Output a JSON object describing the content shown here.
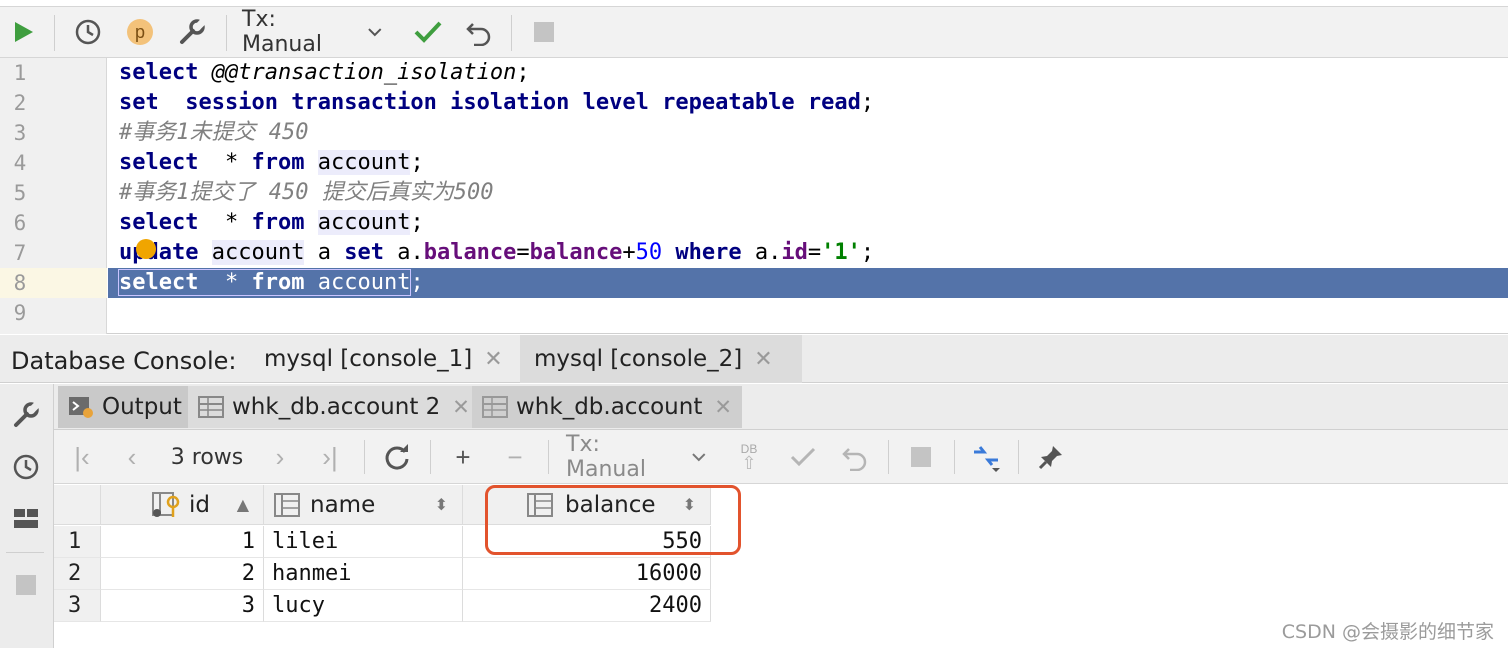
{
  "toolbar": {
    "run_icon": "play-icon",
    "history_icon": "clock-icon",
    "profile_badge": "p",
    "settings_icon": "wrench-icon",
    "tx_mode": "Tx: Manual",
    "commit_icon": "check-icon",
    "rollback_icon": "undo-icon",
    "stop_icon": "stop-icon"
  },
  "editor": {
    "line_numbers": [
      "1",
      "2",
      "3",
      "4",
      "5",
      "6",
      "7",
      "8",
      "9"
    ],
    "lines": {
      "l1_kw": "select",
      "l1_rest": "@@transaction_isolation",
      "l1_end": ";",
      "l2_kw1": "set",
      "l2_kw2": "session",
      "l2_kw3": "transaction",
      "l2_kw4": "isolation",
      "l2_kw5": "level",
      "l2_kw6": "repeatable",
      "l2_kw7": "read",
      "l2_end": ";",
      "l3_comment": "#事务1未提交 450",
      "l4_kw": "select",
      "l4_star": "*",
      "l4_from": "from",
      "l4_table": "account",
      "l4_end": ";",
      "l5_comment": "#事务1提交了 450 提交后真实为500",
      "l6_kw": "select",
      "l6_star": "*",
      "l6_from": "from",
      "l6_table": "account",
      "l6_end": ";",
      "l7_kw": "update",
      "l7_table": "account",
      "l7_alias": "a",
      "l7_set": "set",
      "l7_alias2": "a.",
      "l7_col": "balance",
      "l7_eq": "=",
      "l7_col2": "balance",
      "l7_plus": "+",
      "l7_num": "50",
      "l7_where": "where",
      "l7_alias3": "a.",
      "l7_id": "id",
      "l7_eq2": "=",
      "l7_str": "'1'",
      "l7_end": ";",
      "l8_kw": "select",
      "l8_star": "*",
      "l8_from": "from",
      "l8_table": "account",
      "l8_end": ";"
    }
  },
  "console": {
    "title": "Database Console:",
    "tabs": [
      {
        "label": "mysql [console_1]"
      },
      {
        "label": "mysql [console_2]"
      }
    ]
  },
  "results": {
    "tabs": [
      {
        "label": "Output"
      },
      {
        "label": "whk_db.account 2"
      },
      {
        "label": "whk_db.account"
      }
    ],
    "rows_label": "3 rows",
    "tx_mode": "Tx: Manual",
    "db_badge": "DB",
    "columns": [
      "id",
      "name",
      "balance"
    ],
    "rows": [
      {
        "num": "1",
        "id": "1",
        "name": "lilei",
        "balance": "550"
      },
      {
        "num": "2",
        "id": "2",
        "name": "hanmei",
        "balance": "16000"
      },
      {
        "num": "3",
        "id": "3",
        "name": "lucy",
        "balance": "2400"
      }
    ]
  },
  "watermark": "CSDN @会摄影的细节家",
  "colors": {
    "selection": "#5473a9",
    "highlight_box": "#e2532d",
    "keyword": "#000080",
    "run_green": "#3f9e3f"
  }
}
